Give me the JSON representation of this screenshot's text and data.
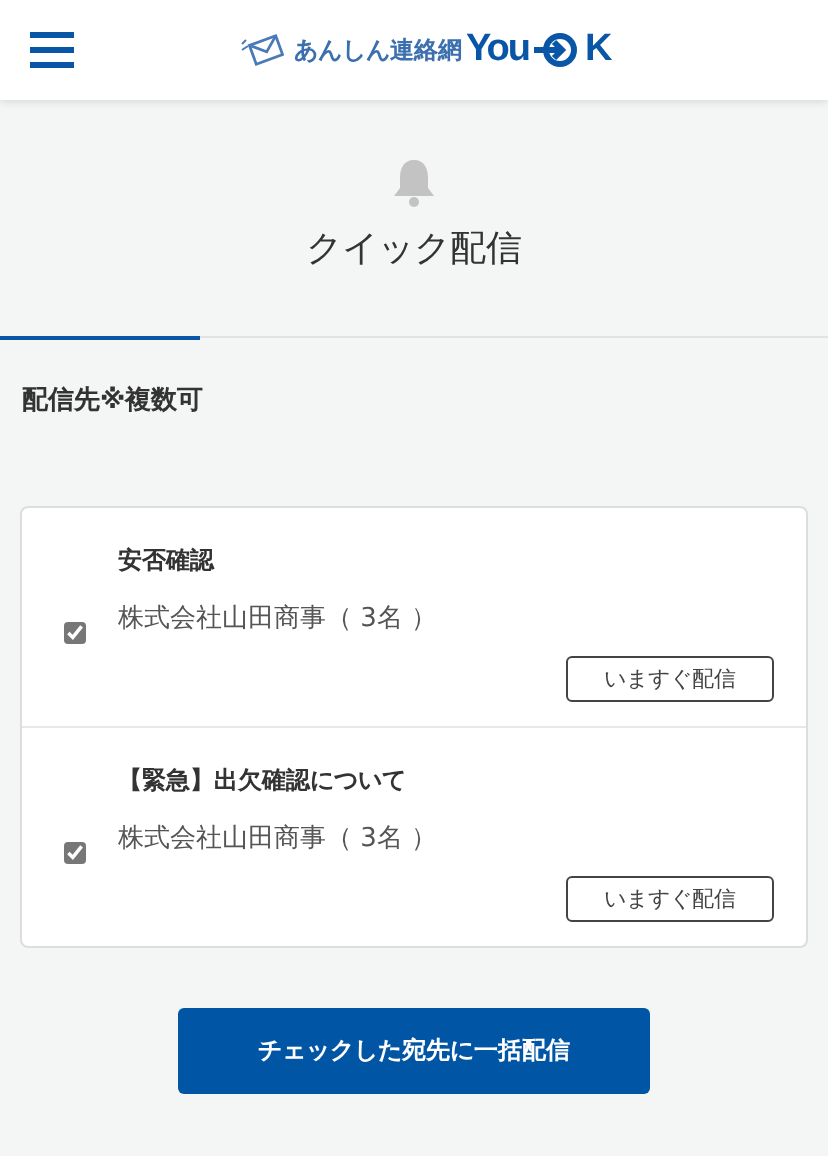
{
  "header": {
    "logo_text": "あんしん連絡網",
    "brand_start": "You",
    "brand_end": "K"
  },
  "page_title": "クイック配信",
  "section_label": "配信先※複数可",
  "messages": [
    {
      "title": "安否確認",
      "recipient": "株式会社山田商事（ 3名 ）",
      "checked": true,
      "send_button": "いますぐ配信"
    },
    {
      "title": "【緊急】出欠確認について",
      "recipient": "株式会社山田商事（ 3名 ）",
      "checked": true,
      "send_button": "いますぐ配信"
    }
  ],
  "bulk_button": "チェックした宛先に一括配信"
}
